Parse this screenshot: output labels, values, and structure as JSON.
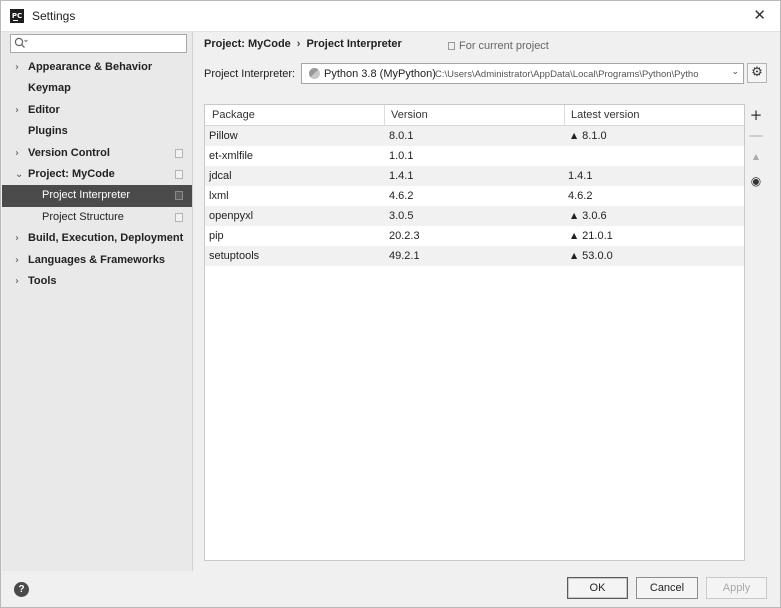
{
  "window": {
    "app_icon_text": "PC",
    "title": "Settings",
    "close_glyph": "✕"
  },
  "search": {
    "placeholder": "",
    "icon": "search-icon"
  },
  "sidebar": {
    "items": [
      {
        "label": "Appearance & Behavior",
        "expandable": true,
        "chevron": "›",
        "level": 0
      },
      {
        "label": "Keymap",
        "expandable": false,
        "chevron": "",
        "level": 0
      },
      {
        "label": "Editor",
        "expandable": true,
        "chevron": "›",
        "level": 0
      },
      {
        "label": "Plugins",
        "expandable": false,
        "chevron": "",
        "level": 0
      },
      {
        "label": "Version Control",
        "expandable": true,
        "chevron": "›",
        "level": 0
      },
      {
        "label": "Project: MyCode",
        "expandable": true,
        "expanded": true,
        "chevron": "⌄",
        "level": 0
      },
      {
        "label": "Project Interpreter",
        "level": 1,
        "selected": true
      },
      {
        "label": "Project Structure",
        "level": 1
      },
      {
        "label": "Build, Execution, Deployment",
        "expandable": true,
        "chevron": "›",
        "level": 0
      },
      {
        "label": "Languages & Frameworks",
        "expandable": true,
        "chevron": "›",
        "level": 0
      },
      {
        "label": "Tools",
        "expandable": true,
        "chevron": "›",
        "level": 0
      }
    ]
  },
  "breadcrumb": {
    "project": "Project: MyCode",
    "separator": "›",
    "page": "Project Interpreter"
  },
  "scope_label": "For current project",
  "interpreter": {
    "label": "Project Interpreter:",
    "name": "Python 3.8 (MyPython)",
    "path": "C:\\Users\\Administrator\\AppData\\Local\\Programs\\Python\\Pytho",
    "arrow": "⌄",
    "settings_glyph": "⚙"
  },
  "table": {
    "columns": [
      "Package",
      "Version",
      "Latest version"
    ],
    "upgrade_glyph": "▲",
    "rows": [
      {
        "package": "Pillow",
        "version": "8.0.1",
        "latest": "8.1.0",
        "upgrade": true
      },
      {
        "package": "et-xmlfile",
        "version": "1.0.1",
        "latest": "",
        "upgrade": false
      },
      {
        "package": "jdcal",
        "version": "1.4.1",
        "latest": "1.4.1",
        "upgrade": false
      },
      {
        "package": "lxml",
        "version": "4.6.2",
        "latest": "4.6.2",
        "upgrade": false
      },
      {
        "package": "openpyxl",
        "version": "3.0.5",
        "latest": "3.0.6",
        "upgrade": true
      },
      {
        "package": "pip",
        "version": "20.2.3",
        "latest": "21.0.1",
        "upgrade": true
      },
      {
        "package": "setuptools",
        "version": "49.2.1",
        "latest": "53.0.0",
        "upgrade": true
      }
    ]
  },
  "toolbar": {
    "add": "+",
    "remove": "—",
    "upgrade": "▲",
    "show_early": "◉"
  },
  "footer": {
    "help": "?",
    "ok": "OK",
    "cancel": "Cancel",
    "apply": "Apply"
  }
}
